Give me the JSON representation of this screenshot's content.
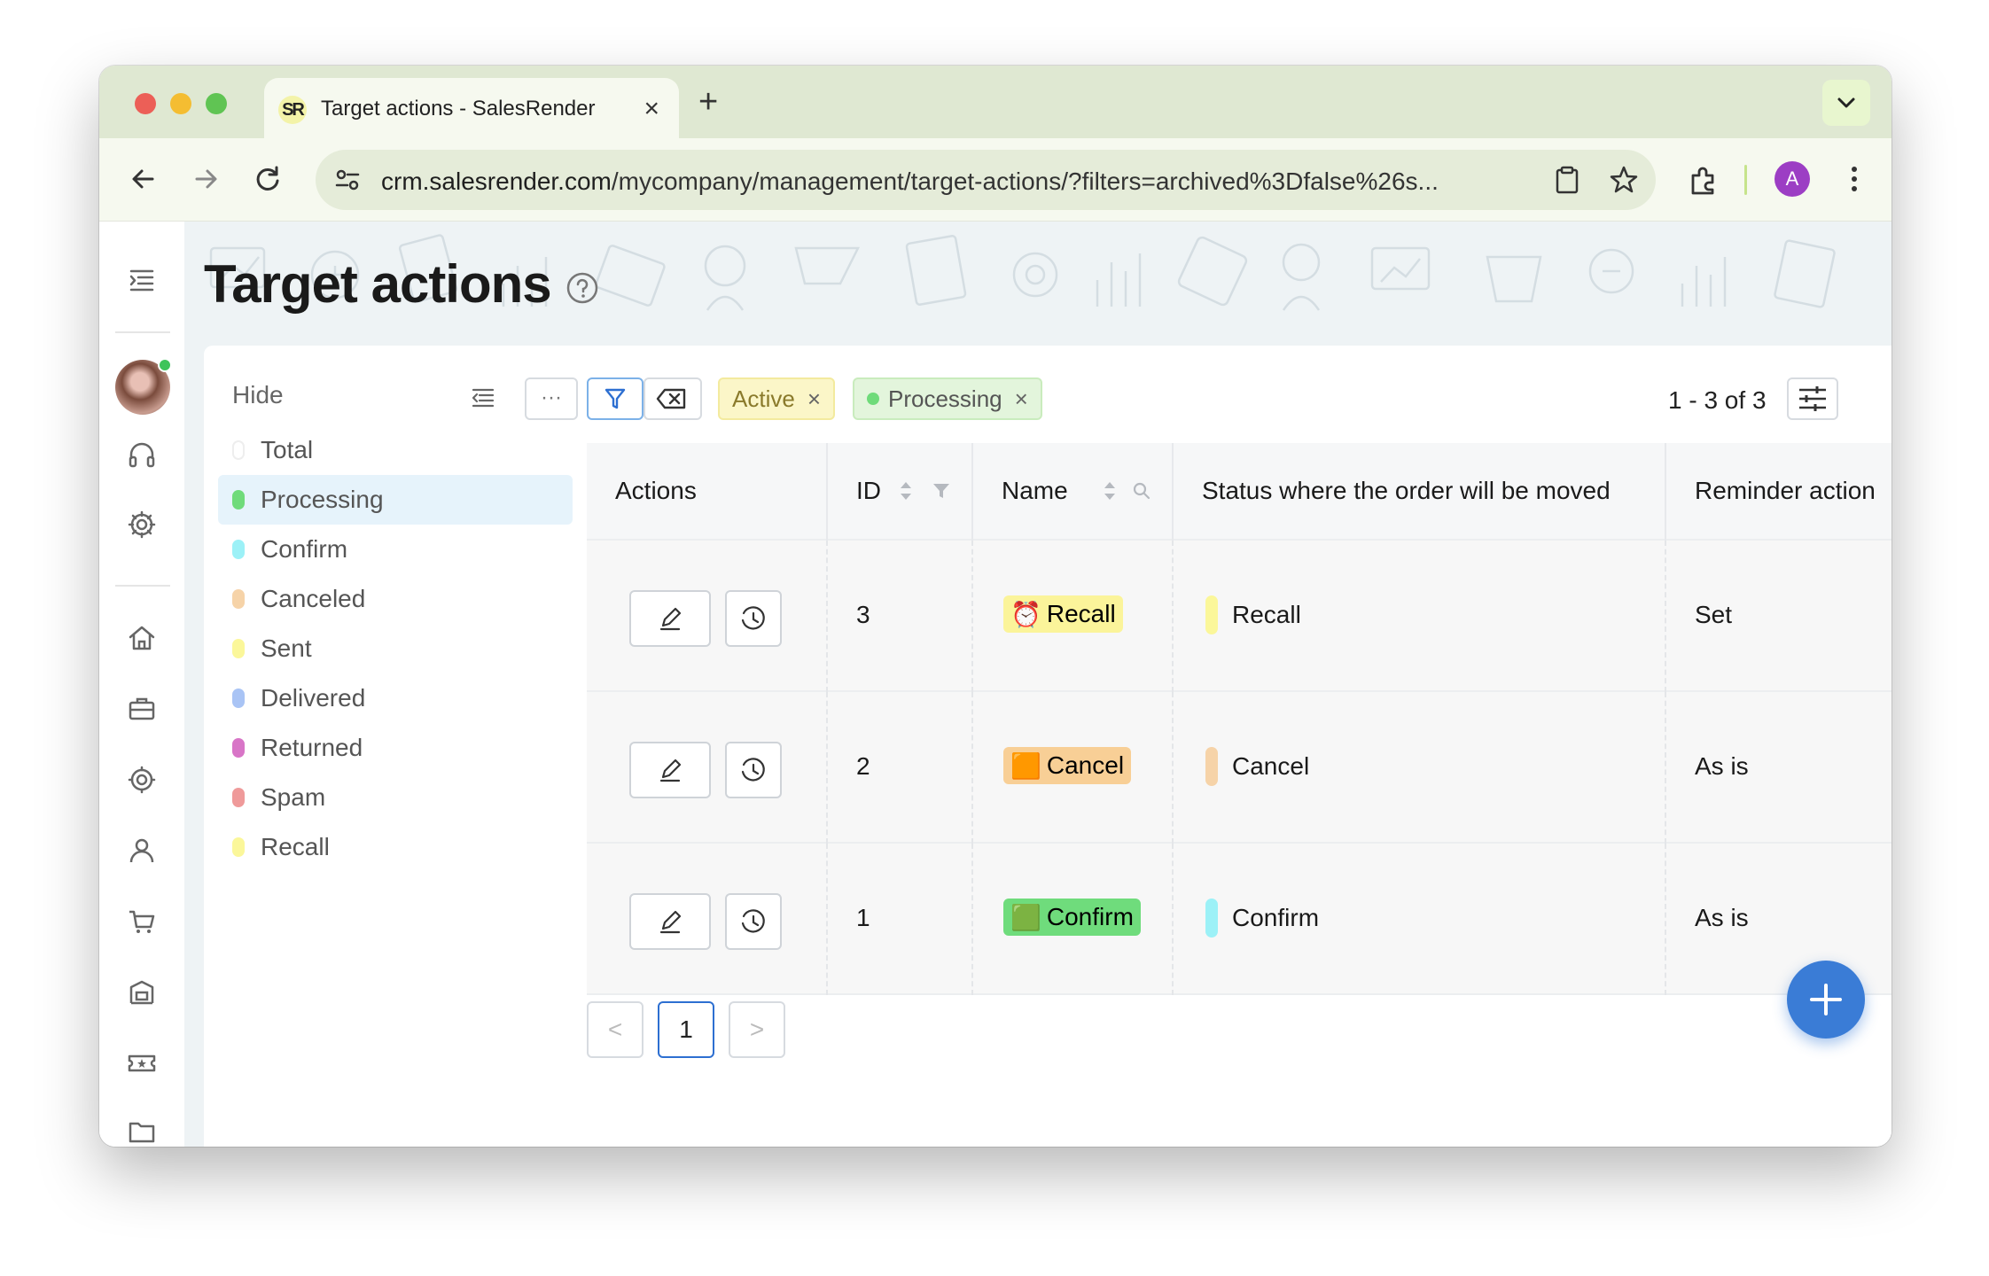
{
  "browser": {
    "tab_title": "Target actions - SalesRender",
    "favicon_text": "SR",
    "url_host": "crm.salesrender.com",
    "url_path": "/mycompany/management/target-actions/?filters=archived%3Dfalse%26s...",
    "profile_initial": "A"
  },
  "page": {
    "title": "Target actions"
  },
  "filter_panel": {
    "hide_label": "Hide",
    "statuses": [
      {
        "label": "Total",
        "color": "#ffffff"
      },
      {
        "label": "Processing",
        "color": "#6fdb7a"
      },
      {
        "label": "Confirm",
        "color": "#9cf1f7"
      },
      {
        "label": "Canceled",
        "color": "#f6d3a8"
      },
      {
        "label": "Sent",
        "color": "#fbf79a"
      },
      {
        "label": "Delivered",
        "color": "#a9c4f5"
      },
      {
        "label": "Returned",
        "color": "#d875c7"
      },
      {
        "label": "Spam",
        "color": "#ef9a9a"
      },
      {
        "label": "Recall",
        "color": "#fbf79a"
      }
    ],
    "selected": "Processing"
  },
  "toolbar": {
    "more_label": "···",
    "chips": [
      {
        "label": "Active",
        "bg": "#fbf6c8",
        "color": "#8a7a2b"
      },
      {
        "label": "Processing",
        "bg": "#e3f5dc",
        "color": "#555",
        "dot": "#6fdb7a"
      }
    ],
    "count_label": "1 - 3 of 3"
  },
  "table": {
    "columns": [
      "Actions",
      "ID",
      "Name",
      "Status where the order will be moved",
      "Reminder action"
    ],
    "rows": [
      {
        "id": "3",
        "name": "Recall",
        "name_emoji": "⏰",
        "name_bg": "#fbf49a",
        "status": "Recall",
        "status_color": "#fbf79a",
        "reminder": "Set"
      },
      {
        "id": "2",
        "name": "Cancel",
        "name_emoji": "🟧",
        "name_bg": "#f8cf96",
        "status": "Cancel",
        "status_color": "#f6d3a8",
        "reminder": "As is"
      },
      {
        "id": "1",
        "name": "Confirm",
        "name_emoji": "🟩",
        "name_bg": "#6fdc7c",
        "status": "Confirm",
        "status_color": "#9cf1f7",
        "reminder": "As is"
      }
    ]
  },
  "pagination": {
    "prev": "<",
    "current": "1",
    "next": ">"
  },
  "colors": {
    "accent": "#3a7cd6",
    "selected_row": "#e6f3fb"
  }
}
